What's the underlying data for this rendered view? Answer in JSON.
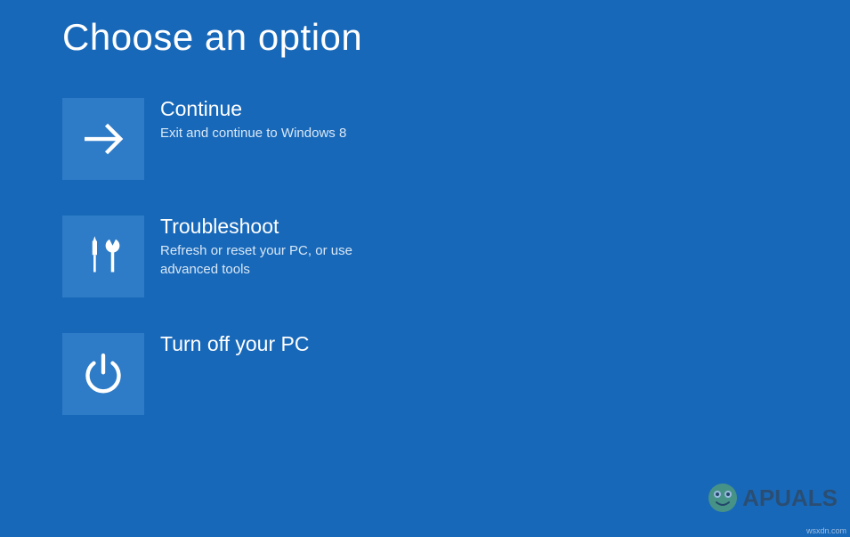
{
  "page": {
    "title": "Choose an option"
  },
  "options": {
    "continue": {
      "title": "Continue",
      "desc": "Exit and continue to Windows 8"
    },
    "troubleshoot": {
      "title": "Troubleshoot",
      "desc": "Refresh or reset your PC, or use advanced tools"
    },
    "poweroff": {
      "title": "Turn off your PC",
      "desc": ""
    }
  },
  "watermark": {
    "brand_pre": "A",
    "brand_post": "PUALS"
  },
  "attribution": "wsxdn.com"
}
